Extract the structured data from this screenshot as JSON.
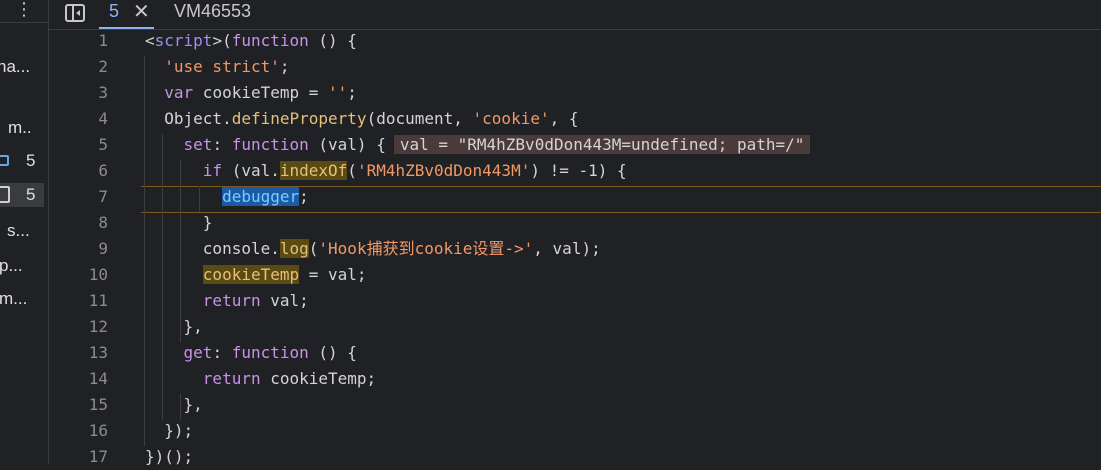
{
  "sidebar": {
    "more_icon": "more-vertical-icon",
    "items": [
      {
        "label": "na...",
        "top": 0
      },
      {
        "label": "m..",
        "top": 0
      },
      {
        "label": "5",
        "icon": "box-icon"
      },
      {
        "label": "5",
        "icon": "file-icon"
      },
      {
        "label": "s...",
        "top": 0
      },
      {
        "label": "p...",
        "top": 0
      },
      {
        "label": "m...",
        "top": 0
      }
    ]
  },
  "tabbar": {
    "toggle_icon": "toggle-navigator-icon",
    "active_tab_label": "5",
    "close_icon": "close-icon",
    "file_name": "VM46553"
  },
  "editor": {
    "line_numbers": [
      "1",
      "2",
      "3",
      "4",
      "5",
      "6",
      "7",
      "8",
      "9",
      "10",
      "11",
      "12",
      "13",
      "14",
      "15",
      "16",
      "17"
    ],
    "lines": [
      "<script>(function () {",
      "  'use strict';",
      "  var cookieTemp = '';",
      "  Object.defineProperty(document, 'cookie', {",
      "    set: function (val) {",
      "      if (val.indexOf('RM4hZBv0dDon443M') != -1) {",
      "        debugger;",
      "      }",
      "      console.log('Hook捕获到cookie设置->', val);",
      "      cookieTemp = val;",
      "      return val;",
      "    },",
      "    get: function () {",
      "      return cookieTemp;",
      "    },",
      "  });",
      "})();"
    ],
    "inline_value": "val = \"RM4hZBv0dDon443M=undefined; path=/\""
  }
}
